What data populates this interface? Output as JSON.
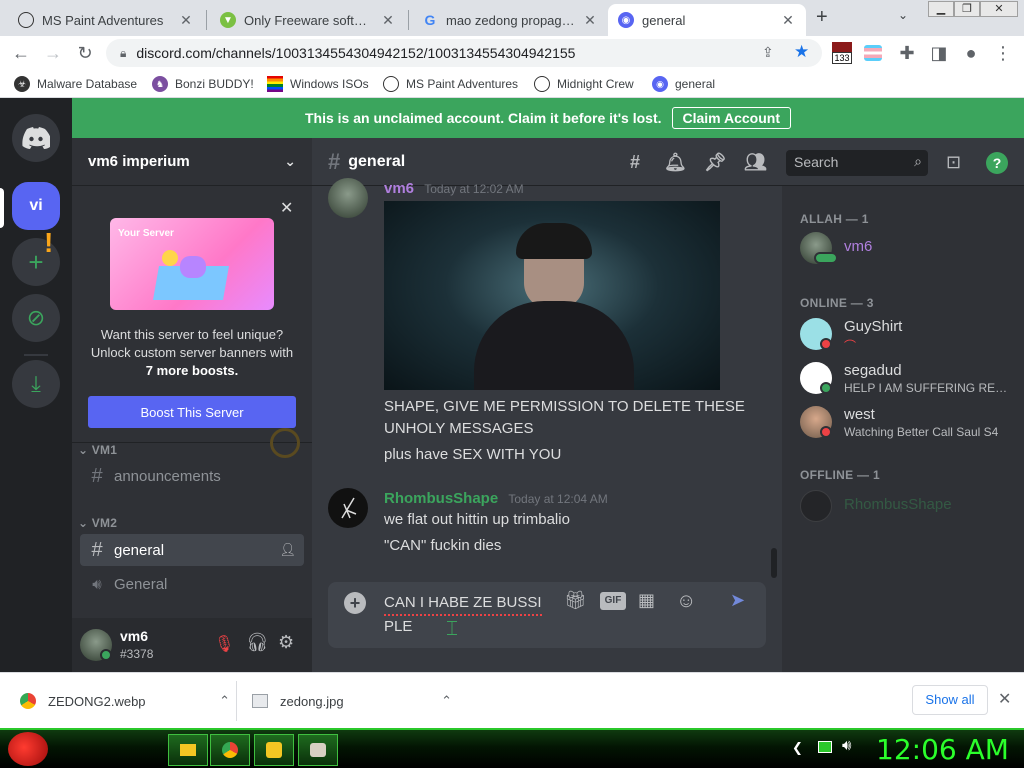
{
  "browser": {
    "tabs": [
      {
        "title": "MS Paint Adventures",
        "active": false
      },
      {
        "title": "Only Freeware software f...",
        "active": false
      },
      {
        "title": "mao zedong propaganda",
        "active": false
      },
      {
        "title": "general",
        "active": true
      }
    ],
    "new_tab": "+",
    "url": "discord.com/channels/1003134554304942152/1003134554304942155",
    "ext_badge": "133",
    "bookmarks": [
      "Malware Database",
      "Bonzi BUDDY!",
      "Windows ISOs",
      "MS Paint Adventures",
      "Midnight Crew",
      "general"
    ]
  },
  "discord": {
    "banner": {
      "text": "This is an unclaimed account. Claim it before it's lost.",
      "button": "Claim Account"
    },
    "server": {
      "name": "vm6 imperium",
      "icon_label": "vi",
      "boost_card": {
        "preview_label": "Your Server",
        "line1": "Want this server to feel unique?",
        "line2": "Unlock custom server banners with",
        "line3": "7 more boosts.",
        "button": "Boost This Server"
      },
      "categories": [
        {
          "name": "VM1",
          "channels": [
            {
              "name": "announcements",
              "type": "text",
              "selected": false
            }
          ]
        },
        {
          "name": "VM2",
          "channels": [
            {
              "name": "general",
              "type": "text",
              "selected": true
            },
            {
              "name": "General",
              "type": "voice",
              "selected": false
            }
          ]
        }
      ]
    },
    "user": {
      "name": "vm6",
      "tag": "#3378"
    },
    "channel": {
      "name": "general"
    },
    "search_placeholder": "Search",
    "messages": [
      {
        "author": "vm6",
        "timestamp": "Today at 12:02 AM",
        "author_color": "#b07fde",
        "lines": [
          "SHAPE, GIVE ME PERMISSION TO DELETE THESE UNHOLY MESSAGES",
          "plus have SEX WITH YOU"
        ]
      },
      {
        "author": "RhombusShape",
        "timestamp": "Today at 12:04 AM",
        "author_color": "#3ba55d",
        "lines": [
          "we flat out hittin up trimbalio",
          "\"CAN\" fuckin dies"
        ]
      }
    ],
    "composer_text_line1": "CAN  I HABE ZE BUSSI",
    "composer_text_line2": "PLE",
    "members": {
      "groups": [
        {
          "label": "ALLAH — 1",
          "members": [
            {
              "name": "vm6",
              "status": "",
              "color": "#b07fde"
            }
          ]
        },
        {
          "label": "ONLINE — 3",
          "members": [
            {
              "name": "GuyShirt",
              "status": "",
              "color": "#dcddde"
            },
            {
              "name": "segadud",
              "status": "HELP I AM SUFFERING REREA...",
              "color": "#dcddde"
            },
            {
              "name": "west",
              "status": "Watching Better Call Saul S4",
              "color": "#dcddde"
            }
          ]
        },
        {
          "label": "OFFLINE — 1",
          "members": [
            {
              "name": "RhombusShape",
              "status": "",
              "color": "#3ba55d"
            }
          ]
        }
      ]
    }
  },
  "downloads": {
    "items": [
      "ZEDONG2.webp",
      "zedong.jpg"
    ],
    "show_all": "Show all"
  },
  "taskbar": {
    "clock": "12:06 AM"
  },
  "colors": {
    "accent": "#5865f2",
    "green": "#3ba55d",
    "bg": "#36393f"
  }
}
